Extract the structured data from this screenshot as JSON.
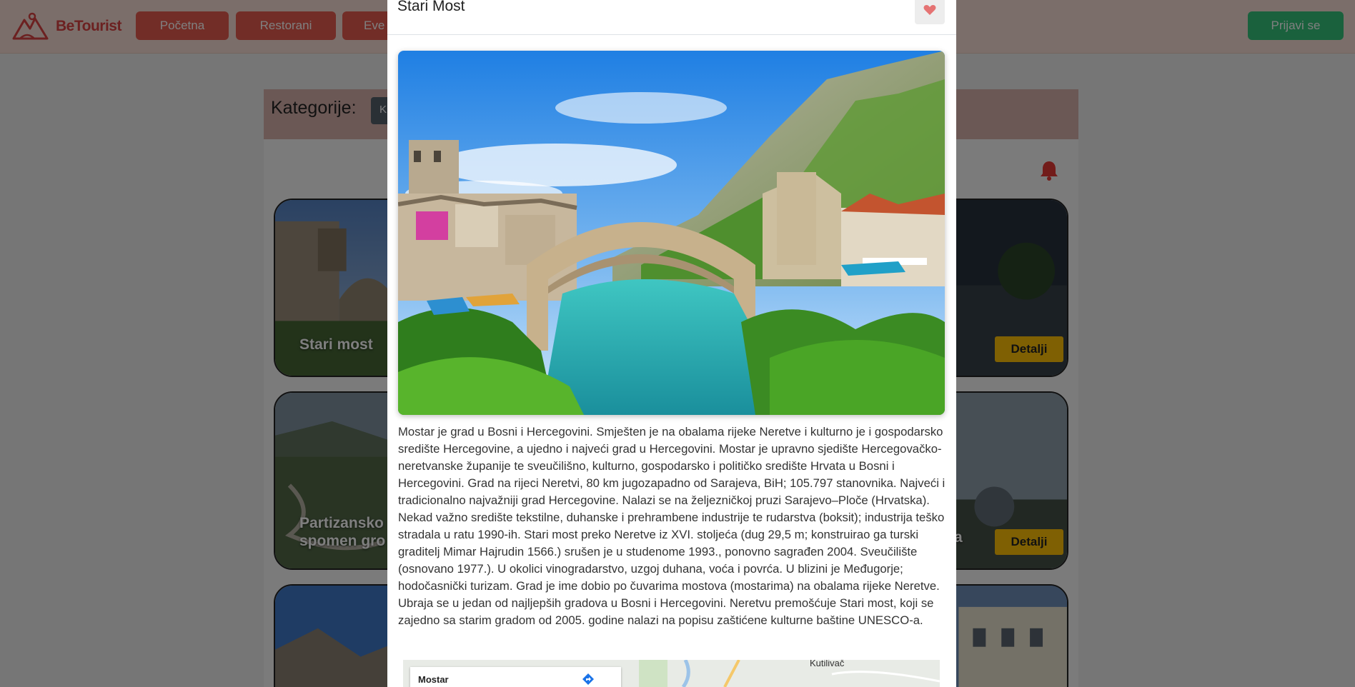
{
  "brand": {
    "name": "BeTourist",
    "color": "#d94242"
  },
  "nav": {
    "items": [
      {
        "label": "Početna"
      },
      {
        "label": "Restorani"
      },
      {
        "label": "Eve"
      }
    ],
    "login_label": "Prijavi se"
  },
  "categories": {
    "label": "Kategorije:",
    "select_value": "K"
  },
  "cards": [
    {
      "title": "Stari most",
      "button": "Detalji"
    },
    {
      "title": "Partizansko spomen gro",
      "button": "Detalji"
    },
    {
      "title": "a",
      "button": ""
    }
  ],
  "modal": {
    "title": "Stari Most",
    "favorite_icon": "heart-icon",
    "description": "Mostar je grad u Bosni i Hercegovini. Smješten je na obalama rijeke Neretve i kulturno je i gospodarsko središte Hercegovine, a ujedno i najveći grad u Hercegovini. Mostar je upravno sjedište Hercegovačko-neretvanske županije te sveučilišno, kulturno, gospodarsko i političko središte Hrvata u Bosni i Hercegovini. Grad na rijeci Neretvi, 80 km jugozapadno od Sarajeva, BiH; 105.797 stanovnika. Najveći i tradicionalno najvažniji grad Hercegovine. Nalazi se na željezničkoj pruzi Sarajevo–Ploče (Hrvatska). Nekad važno središte tekstilne, duhanske i prehrambene industrije te rudarstva (boksit); industrija teško stradala u ratu 1990-ih. Stari most preko Neretve iz XVI. stoljeća (dug 29,5 m; konstruirao ga turski graditelj Mimar Hajrudin 1566.) srušen je u studenome 1993., ponovno sagrađen 2004. Sveučilište (osnovano 1977.). U okolici vinogradarstvo, uzgoj duhana, voća i povrća. U blizini je Međugorje; hodočasnički turizam. Grad je ime dobio po čuvarima mostova (mostarima) na obalama rijeke Neretve. Ubraja se u jedan od najljepših gradova u Bosni i Hercegovini. Neretvu premošćuje Stari most, koji se zajedno sa starim gradom od 2005. godine nalazi na popisu zaštićene kulturne baštine UNESCO-a.",
    "map": {
      "city": "Mostar",
      "place": "Kutilivač"
    }
  }
}
